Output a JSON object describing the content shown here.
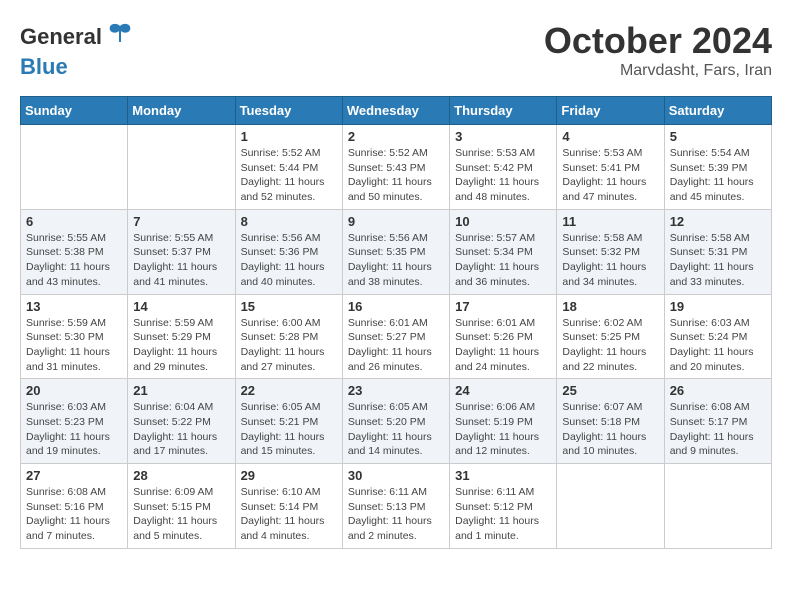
{
  "logo": {
    "general": "General",
    "blue": "Blue"
  },
  "title": "October 2024",
  "location": "Marvdasht, Fars, Iran",
  "days_header": [
    "Sunday",
    "Monday",
    "Tuesday",
    "Wednesday",
    "Thursday",
    "Friday",
    "Saturday"
  ],
  "weeks": [
    [
      {
        "day": "",
        "info": ""
      },
      {
        "day": "",
        "info": ""
      },
      {
        "day": "1",
        "info": "Sunrise: 5:52 AM\nSunset: 5:44 PM\nDaylight: 11 hours and 52 minutes."
      },
      {
        "day": "2",
        "info": "Sunrise: 5:52 AM\nSunset: 5:43 PM\nDaylight: 11 hours and 50 minutes."
      },
      {
        "day": "3",
        "info": "Sunrise: 5:53 AM\nSunset: 5:42 PM\nDaylight: 11 hours and 48 minutes."
      },
      {
        "day": "4",
        "info": "Sunrise: 5:53 AM\nSunset: 5:41 PM\nDaylight: 11 hours and 47 minutes."
      },
      {
        "day": "5",
        "info": "Sunrise: 5:54 AM\nSunset: 5:39 PM\nDaylight: 11 hours and 45 minutes."
      }
    ],
    [
      {
        "day": "6",
        "info": "Sunrise: 5:55 AM\nSunset: 5:38 PM\nDaylight: 11 hours and 43 minutes."
      },
      {
        "day": "7",
        "info": "Sunrise: 5:55 AM\nSunset: 5:37 PM\nDaylight: 11 hours and 41 minutes."
      },
      {
        "day": "8",
        "info": "Sunrise: 5:56 AM\nSunset: 5:36 PM\nDaylight: 11 hours and 40 minutes."
      },
      {
        "day": "9",
        "info": "Sunrise: 5:56 AM\nSunset: 5:35 PM\nDaylight: 11 hours and 38 minutes."
      },
      {
        "day": "10",
        "info": "Sunrise: 5:57 AM\nSunset: 5:34 PM\nDaylight: 11 hours and 36 minutes."
      },
      {
        "day": "11",
        "info": "Sunrise: 5:58 AM\nSunset: 5:32 PM\nDaylight: 11 hours and 34 minutes."
      },
      {
        "day": "12",
        "info": "Sunrise: 5:58 AM\nSunset: 5:31 PM\nDaylight: 11 hours and 33 minutes."
      }
    ],
    [
      {
        "day": "13",
        "info": "Sunrise: 5:59 AM\nSunset: 5:30 PM\nDaylight: 11 hours and 31 minutes."
      },
      {
        "day": "14",
        "info": "Sunrise: 5:59 AM\nSunset: 5:29 PM\nDaylight: 11 hours and 29 minutes."
      },
      {
        "day": "15",
        "info": "Sunrise: 6:00 AM\nSunset: 5:28 PM\nDaylight: 11 hours and 27 minutes."
      },
      {
        "day": "16",
        "info": "Sunrise: 6:01 AM\nSunset: 5:27 PM\nDaylight: 11 hours and 26 minutes."
      },
      {
        "day": "17",
        "info": "Sunrise: 6:01 AM\nSunset: 5:26 PM\nDaylight: 11 hours and 24 minutes."
      },
      {
        "day": "18",
        "info": "Sunrise: 6:02 AM\nSunset: 5:25 PM\nDaylight: 11 hours and 22 minutes."
      },
      {
        "day": "19",
        "info": "Sunrise: 6:03 AM\nSunset: 5:24 PM\nDaylight: 11 hours and 20 minutes."
      }
    ],
    [
      {
        "day": "20",
        "info": "Sunrise: 6:03 AM\nSunset: 5:23 PM\nDaylight: 11 hours and 19 minutes."
      },
      {
        "day": "21",
        "info": "Sunrise: 6:04 AM\nSunset: 5:22 PM\nDaylight: 11 hours and 17 minutes."
      },
      {
        "day": "22",
        "info": "Sunrise: 6:05 AM\nSunset: 5:21 PM\nDaylight: 11 hours and 15 minutes."
      },
      {
        "day": "23",
        "info": "Sunrise: 6:05 AM\nSunset: 5:20 PM\nDaylight: 11 hours and 14 minutes."
      },
      {
        "day": "24",
        "info": "Sunrise: 6:06 AM\nSunset: 5:19 PM\nDaylight: 11 hours and 12 minutes."
      },
      {
        "day": "25",
        "info": "Sunrise: 6:07 AM\nSunset: 5:18 PM\nDaylight: 11 hours and 10 minutes."
      },
      {
        "day": "26",
        "info": "Sunrise: 6:08 AM\nSunset: 5:17 PM\nDaylight: 11 hours and 9 minutes."
      }
    ],
    [
      {
        "day": "27",
        "info": "Sunrise: 6:08 AM\nSunset: 5:16 PM\nDaylight: 11 hours and 7 minutes."
      },
      {
        "day": "28",
        "info": "Sunrise: 6:09 AM\nSunset: 5:15 PM\nDaylight: 11 hours and 5 minutes."
      },
      {
        "day": "29",
        "info": "Sunrise: 6:10 AM\nSunset: 5:14 PM\nDaylight: 11 hours and 4 minutes."
      },
      {
        "day": "30",
        "info": "Sunrise: 6:11 AM\nSunset: 5:13 PM\nDaylight: 11 hours and 2 minutes."
      },
      {
        "day": "31",
        "info": "Sunrise: 6:11 AM\nSunset: 5:12 PM\nDaylight: 11 hours and 1 minute."
      },
      {
        "day": "",
        "info": ""
      },
      {
        "day": "",
        "info": ""
      }
    ]
  ]
}
